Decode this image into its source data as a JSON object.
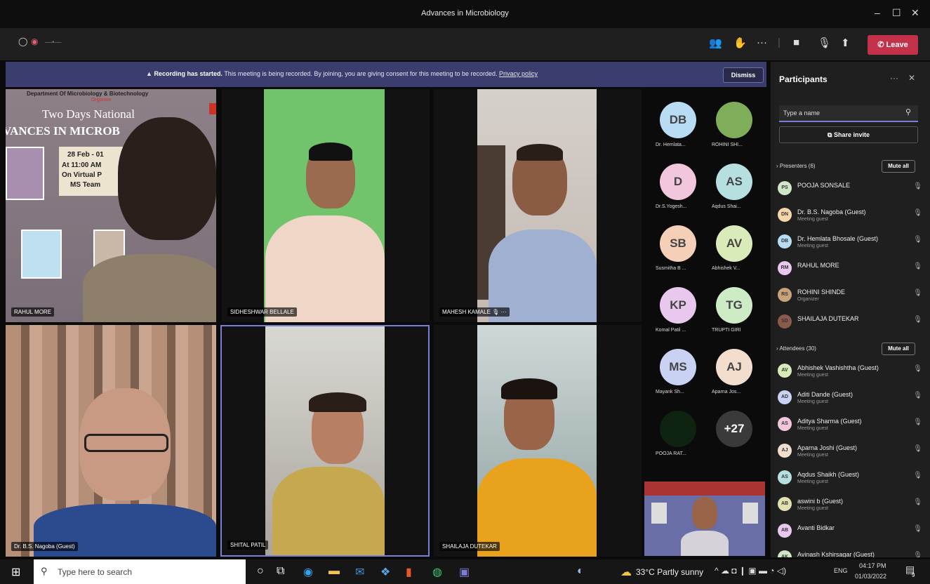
{
  "window": {
    "title": "Advances in Microbiology"
  },
  "toolbar": {
    "leave_label": "Leave"
  },
  "banner": {
    "bold": "Recording has started.",
    "text": "This meeting is being recorded. By joining, you are giving consent for this meeting to be recorded.",
    "link": "Privacy policy",
    "dismiss": "Dismiss"
  },
  "poster": {
    "dept": "Department Of Microbiology & Biotechnology",
    "organize": "Organise",
    "line1": "Two Days National",
    "line2": "VANCES IN MICROB",
    "date": "28 Feb - 01",
    "time": "At 11:00 AM",
    "venue": "On Virtual P",
    "platform": "MS Team"
  },
  "tiles": {
    "t1": "RAHUL MORE",
    "t2": "SIDHESHWAR BELLALE",
    "t3": "MAHESH KAMALE",
    "t4": "Dr. B.S. Nagoba (Guest)",
    "t5": "SHITAL PATIL",
    "t6": "SHAILAJA DUTEKAR"
  },
  "gallery": [
    {
      "initials": "DB",
      "name": "Dr. Hemlata...",
      "color": "#b7dcf4"
    },
    {
      "initials": "",
      "name": "ROHINI SHI...",
      "color": "#7fae5b"
    },
    {
      "initials": "D",
      "name": "Dr.S.Yogesh...",
      "color": "#f2c6dd"
    },
    {
      "initials": "AS",
      "name": "Aqdus Shai...",
      "color": "#b6e0e0"
    },
    {
      "initials": "SB",
      "name": "Susmitha B ...",
      "color": "#f6cfb8"
    },
    {
      "initials": "AV",
      "name": "Abhishek V...",
      "color": "#d9ebb9"
    },
    {
      "initials": "KP",
      "name": "Komal Patil ...",
      "color": "#e9c8ee"
    },
    {
      "initials": "TG",
      "name": "TRUPTI GIRI",
      "color": "#cdebc4"
    },
    {
      "initials": "MS",
      "name": "Mayank Sh...",
      "color": "#c9d2f2"
    },
    {
      "initials": "AJ",
      "name": "Aparna Jos...",
      "color": "#f3ddcd"
    },
    {
      "initials": "",
      "name": "POOJA RAT...",
      "color": "#0e2310"
    },
    {
      "initials": "+27",
      "name": "",
      "color": "#3a3a3a"
    }
  ],
  "participants": {
    "title": "Participants",
    "search_placeholder": "Type a name",
    "share_invite": "Share invite",
    "presenters_label": "Presenters (6)",
    "attendees_label": "Attendees (30)",
    "mute_all": "Mute all",
    "presenters": [
      {
        "initials": "PS",
        "name": "POOJA SONSALE",
        "sub": "",
        "color": "#cfe6c7"
      },
      {
        "initials": "DN",
        "name": "Dr. B.S. Nagoba (Guest)",
        "sub": "Meeting guest",
        "color": "#f6d6a8"
      },
      {
        "initials": "DB",
        "name": "Dr. Hemlata Bhosale (Guest)",
        "sub": "Meeting guest",
        "color": "#b7dcf4"
      },
      {
        "initials": "RM",
        "name": "RAHUL MORE",
        "sub": "",
        "color": "#e9c8ee"
      },
      {
        "initials": "RS",
        "name": "ROHINI SHINDE",
        "sub": "Organizer",
        "color": "#c9a27a"
      },
      {
        "initials": "SD",
        "name": "SHAILAJA DUTEKAR",
        "sub": "",
        "color": "#8a5a4a"
      }
    ],
    "attendees": [
      {
        "initials": "AV",
        "name": "Abhishek Vashishtha (Guest)",
        "sub": "Meeting guest",
        "color": "#d9ebb9"
      },
      {
        "initials": "AD",
        "name": "Aditi Dande (Guest)",
        "sub": "Meeting guest",
        "color": "#c9d2f2"
      },
      {
        "initials": "AS",
        "name": "Aditya Sharma (Guest)",
        "sub": "Meeting guest",
        "color": "#f2c6dd"
      },
      {
        "initials": "AJ",
        "name": "Aparna Joshi (Guest)",
        "sub": "Meeting guest",
        "color": "#f3ddcd"
      },
      {
        "initials": "AS",
        "name": "Aqdus Shaikh (Guest)",
        "sub": "Meeting guest",
        "color": "#b6e0e0"
      },
      {
        "initials": "AB",
        "name": "aswini b (Guest)",
        "sub": "Meeting guest",
        "color": "#e0e0b0"
      },
      {
        "initials": "AB",
        "name": "Avanti Bidkar",
        "sub": "",
        "color": "#e9c8ee"
      },
      {
        "initials": "AK",
        "name": "Avinash Kshirsagar (Guest)",
        "sub": "",
        "color": "#cfe6c7"
      }
    ]
  },
  "taskbar": {
    "search_placeholder": "Type here to search",
    "weather": "33°C  Partly sunny",
    "lang": "ENG",
    "time": "04:17 PM",
    "date": "01/03/2022",
    "notif_count": "9"
  }
}
